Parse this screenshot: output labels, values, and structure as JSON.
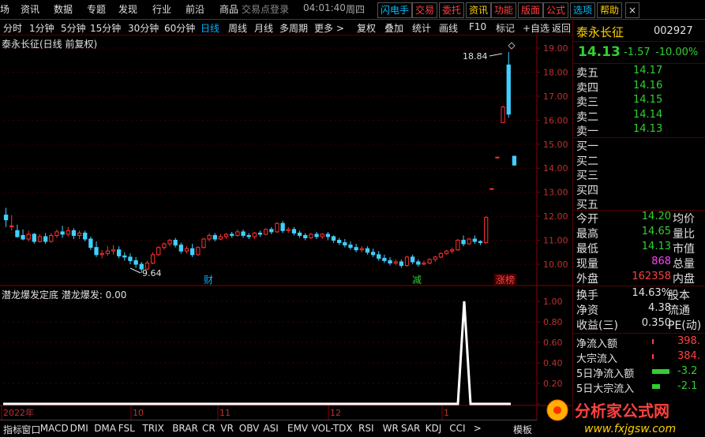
{
  "menu": {
    "items": [
      "场",
      "资讯",
      "数据",
      "专题",
      "发现",
      "行业",
      "前沿",
      "商品"
    ],
    "login_text": "交易点登录",
    "time": "04:01:40",
    "weekday": "周四",
    "tools": [
      {
        "label": "闪电手",
        "color": "#00c0ff"
      },
      {
        "label": "交易",
        "color": "#ff4040"
      },
      {
        "label": "委托",
        "color": "#ff4040"
      },
      {
        "label": "资讯",
        "color": "#ffd000"
      },
      {
        "label": "功能",
        "color": "#ff4040"
      },
      {
        "label": "版面",
        "color": "#ff4040"
      },
      {
        "label": "公式",
        "color": "#ff4040"
      },
      {
        "label": "选项",
        "color": "#00c0ff"
      },
      {
        "label": "帮助",
        "color": "#ffd000"
      }
    ],
    "close": "×"
  },
  "timebar": {
    "items": [
      "分时",
      "1分钟",
      "5分钟",
      "15分钟",
      "30分钟",
      "60分钟",
      "日线",
      "周线",
      "月线",
      "多周期",
      "更多 >",
      "复权",
      "叠加",
      "统计",
      "画线",
      "F10",
      "标记",
      "+自选",
      "返回"
    ],
    "active": "日线"
  },
  "kline_title": "泰永长征(日线 前复权)",
  "indicator_title": "潜龙爆发定底  潜龙爆发: 0.00",
  "chart_data": {
    "type": "candlestick",
    "title": "泰永长征(日线 前复权)",
    "y_axis_main": {
      "min": 9.4,
      "max": 19.2,
      "ticks": [
        10.0,
        11.0,
        12.0,
        13.0,
        14.0,
        15.0,
        16.0,
        17.0,
        18.0,
        19.0
      ]
    },
    "y_axis_indicator": {
      "min": 0,
      "max": 1.05,
      "ticks": [
        0.0,
        0.2,
        0.4,
        0.6,
        0.8,
        1.0
      ]
    },
    "x_axis_labels": [
      "2022年",
      "10",
      "11",
      "12",
      "1"
    ],
    "annotations": [
      {
        "text": "18.84",
        "type": "high"
      },
      {
        "text": "9.64",
        "type": "low"
      },
      {
        "text": "财",
        "color": "#00b0ff"
      },
      {
        "text": "减",
        "color": "#30d030"
      },
      {
        "text": "涨榜",
        "color": "#ff4040"
      }
    ],
    "candles": [
      [
        12.05,
        12.35,
        11.85,
        11.55
      ],
      [
        11.6,
        12.05,
        11.6,
        11.4
      ],
      [
        11.4,
        11.65,
        11.15,
        11.1
      ],
      [
        11.2,
        11.45,
        11.05,
        11.0
      ],
      [
        11.05,
        11.4,
        11.25,
        10.95
      ],
      [
        11.25,
        11.3,
        10.95,
        10.85
      ],
      [
        10.95,
        11.25,
        11.15,
        10.9
      ],
      [
        11.15,
        11.3,
        10.95,
        10.85
      ],
      [
        10.95,
        11.3,
        11.2,
        10.9
      ],
      [
        11.2,
        11.45,
        11.35,
        11.1
      ],
      [
        11.35,
        11.6,
        11.25,
        11.1
      ],
      [
        11.25,
        11.55,
        11.4,
        11.15
      ],
      [
        11.4,
        11.5,
        11.2,
        11.05
      ],
      [
        11.2,
        11.4,
        11.3,
        11.05
      ],
      [
        11.3,
        11.4,
        11.05,
        10.95
      ],
      [
        11.05,
        11.15,
        10.7,
        10.6
      ],
      [
        10.7,
        10.95,
        10.4,
        10.3
      ],
      [
        10.4,
        10.6,
        10.45,
        10.25
      ],
      [
        10.45,
        10.75,
        10.55,
        10.35
      ],
      [
        10.55,
        10.8,
        10.6,
        10.4
      ],
      [
        10.6,
        10.75,
        10.35,
        10.25
      ],
      [
        10.35,
        10.5,
        10.3,
        10.15
      ],
      [
        10.3,
        10.45,
        10.15,
        10.0
      ],
      [
        10.15,
        10.3,
        10.0,
        9.85
      ],
      [
        10.0,
        10.1,
        9.8,
        9.64
      ],
      [
        9.8,
        10.15,
        10.05,
        9.75
      ],
      [
        10.05,
        10.5,
        10.4,
        10.0
      ],
      [
        10.4,
        10.75,
        10.7,
        10.35
      ],
      [
        10.7,
        10.9,
        10.85,
        10.6
      ],
      [
        10.85,
        11.05,
        11.0,
        10.75
      ],
      [
        11.0,
        11.1,
        10.8,
        10.7
      ],
      [
        10.8,
        10.9,
        10.55,
        10.45
      ],
      [
        10.55,
        10.75,
        10.65,
        10.45
      ],
      [
        10.65,
        10.85,
        10.4,
        10.3
      ],
      [
        10.4,
        10.75,
        10.7,
        10.35
      ],
      [
        10.7,
        11.1,
        11.05,
        10.65
      ],
      [
        11.05,
        11.3,
        11.2,
        10.95
      ],
      [
        11.2,
        11.3,
        11.05,
        10.95
      ],
      [
        11.05,
        11.25,
        11.15,
        11.0
      ],
      [
        11.15,
        11.3,
        11.25,
        11.05
      ],
      [
        11.25,
        11.35,
        11.2,
        11.1
      ],
      [
        11.2,
        11.45,
        11.35,
        11.15
      ],
      [
        11.35,
        11.45,
        11.2,
        11.1
      ],
      [
        11.2,
        11.3,
        11.15,
        11.05
      ],
      [
        11.15,
        11.35,
        11.3,
        11.05
      ],
      [
        11.3,
        11.4,
        11.25,
        11.15
      ],
      [
        11.25,
        11.5,
        11.45,
        11.2
      ],
      [
        11.45,
        11.55,
        11.35,
        11.25
      ],
      [
        11.35,
        11.75,
        11.7,
        11.3
      ],
      [
        11.7,
        11.8,
        11.4,
        11.3
      ],
      [
        11.4,
        11.55,
        11.45,
        11.3
      ],
      [
        11.45,
        11.55,
        11.3,
        11.2
      ],
      [
        11.3,
        11.4,
        11.2,
        11.1
      ],
      [
        11.2,
        11.3,
        11.1,
        11.0
      ],
      [
        11.1,
        11.3,
        11.25,
        11.05
      ],
      [
        11.25,
        11.35,
        11.15,
        11.05
      ],
      [
        11.15,
        11.3,
        11.25,
        11.05
      ],
      [
        11.25,
        11.35,
        11.15,
        11.0
      ],
      [
        11.15,
        11.2,
        11.0,
        10.9
      ],
      [
        11.0,
        11.1,
        10.9,
        10.8
      ],
      [
        10.9,
        11.05,
        10.8,
        10.7
      ],
      [
        10.8,
        10.95,
        10.7,
        10.6
      ],
      [
        10.7,
        10.85,
        10.6,
        10.5
      ],
      [
        10.6,
        10.75,
        10.65,
        10.5
      ],
      [
        10.65,
        10.75,
        10.5,
        10.4
      ],
      [
        10.5,
        10.65,
        10.4,
        10.3
      ],
      [
        10.4,
        10.55,
        10.25,
        10.15
      ],
      [
        10.25,
        10.4,
        10.15,
        10.05
      ],
      [
        10.15,
        10.3,
        10.05,
        9.95
      ],
      [
        10.05,
        10.2,
        10.1,
        9.95
      ],
      [
        10.1,
        10.2,
        9.95,
        9.85
      ],
      [
        9.95,
        10.35,
        10.3,
        9.9
      ],
      [
        10.3,
        10.4,
        10.1,
        10.0
      ],
      [
        10.1,
        10.2,
        10.0,
        9.9
      ],
      [
        10.0,
        10.15,
        10.05,
        9.95
      ],
      [
        10.05,
        10.25,
        10.2,
        10.0
      ],
      [
        10.2,
        10.35,
        10.3,
        10.1
      ],
      [
        10.3,
        10.5,
        10.45,
        10.25
      ],
      [
        10.45,
        10.6,
        10.55,
        10.4
      ],
      [
        10.55,
        10.7,
        10.6,
        10.45
      ],
      [
        10.6,
        11.05,
        11.0,
        10.55
      ],
      [
        11.0,
        11.2,
        10.85,
        10.75
      ],
      [
        10.85,
        11.1,
        11.05,
        10.8
      ],
      [
        11.05,
        11.2,
        10.95,
        10.85
      ],
      [
        10.95,
        11.0,
        10.9,
        10.8
      ],
      [
        10.9,
        12.0,
        11.95,
        10.85
      ],
      [
        13.15,
        13.15,
        13.15,
        13.15
      ],
      [
        14.46,
        14.46,
        14.46,
        14.46
      ],
      [
        15.9,
        16.6,
        16.55,
        15.9
      ],
      [
        18.3,
        18.84,
        16.25,
        16.1
      ],
      [
        14.5,
        14.5,
        14.13,
        14.1
      ]
    ],
    "indicator": {
      "name": "潜龙爆发",
      "values_note": "spike",
      "spike_value": 1.0
    }
  },
  "bottom_tabs": [
    "指标",
    "窗口",
    "MACD",
    "DMI",
    "DMA",
    "FSL",
    "TRIX",
    "BRAR",
    "CR",
    "VR",
    "OBV",
    "ASI",
    "EMV",
    "VOL-TDX",
    "RSI",
    "WR",
    "SAR",
    "KDJ",
    "CCI",
    ">",
    "模板"
  ],
  "quote": {
    "name": "泰永长征",
    "code": "002927",
    "price": "14.13",
    "change": "-1.57",
    "pct": "-10.00%",
    "sell": [
      {
        "label": "卖五",
        "price": "14.17"
      },
      {
        "label": "卖四",
        "price": "14.16"
      },
      {
        "label": "卖三",
        "price": "14.15"
      },
      {
        "label": "卖二",
        "price": "14.14"
      },
      {
        "label": "卖一",
        "price": "14.13"
      }
    ],
    "buy": [
      "买一",
      "买二",
      "买三",
      "买四",
      "买五"
    ],
    "stats": [
      {
        "l1": "今开",
        "v1": "14.20",
        "c1": "green",
        "l2": "均价"
      },
      {
        "l1": "最高",
        "v1": "14.65",
        "c1": "green",
        "l2": "量比"
      },
      {
        "l1": "最低",
        "v1": "14.13",
        "c1": "green",
        "l2": "市值"
      },
      {
        "l1": "现量",
        "v1": "868",
        "c1": "magenta",
        "l2": "总量"
      },
      {
        "l1": "外盘",
        "v1": "162358",
        "c1": "red",
        "l2": "内盘"
      }
    ],
    "stats2": [
      {
        "l1": "换手",
        "v1": "14.63%",
        "c1": "white",
        "l2": "股本"
      },
      {
        "l1": "净资",
        "v1": "4.38",
        "c1": "white",
        "l2": "流通"
      },
      {
        "l1": "收益(三)",
        "v1": "0.350",
        "c1": "white",
        "l2": "PE(动)"
      }
    ],
    "flows": [
      {
        "label": "净流入额",
        "value": "398.",
        "color": "red"
      },
      {
        "label": "大宗流入",
        "value": "384.",
        "color": "red"
      },
      {
        "label": "5日净流入额",
        "value": "-3.2",
        "color": "green"
      },
      {
        "label": "5日大宗流入",
        "value": "-2.1",
        "color": "green"
      }
    ]
  },
  "watermark": {
    "text1": "分析家公式网",
    "text2": "www.fxjgsw.com"
  }
}
